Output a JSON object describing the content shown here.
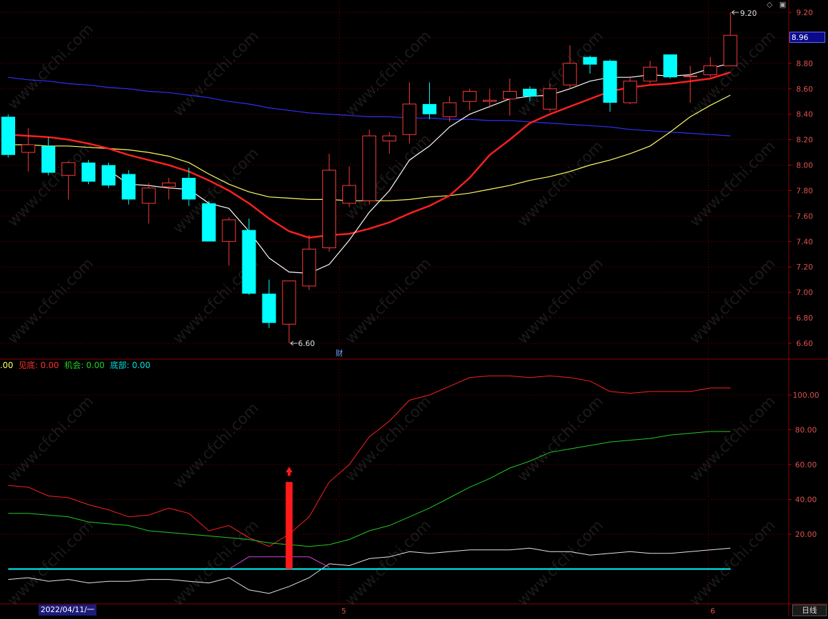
{
  "app": {
    "watermark": "www.cfchi.com",
    "period_label": "日线",
    "cursor_date": "2022/04/11/一",
    "last_price_tag": "8.96",
    "high_marker": "9.20",
    "low_marker": "6.60",
    "event_marker": "财",
    "icons": [
      "diamond-icon",
      "window-icon"
    ]
  },
  "colors": {
    "up": "#ff3b3b",
    "down": "#00ffff",
    "ma5": "#ffffff",
    "ma10": "#ff2020",
    "ma20": "#ffff66",
    "ma60": "#3030ff",
    "grid": "#7a0000",
    "ind_red": "#ff2020",
    "ind_green": "#20d020",
    "ind_white": "#e8e8e8",
    "ind_cyan": "#00ffff",
    "ind_magenta": "#e040e0"
  },
  "legend": [
    {
      "label": ".00",
      "color": "#ffff66"
    },
    {
      "label": "见底: 0.00",
      "color": "#ff3030"
    },
    {
      "label": "机会: 0.00",
      "color": "#20d020"
    },
    {
      "label": "底部: 0.00",
      "color": "#00e0e0"
    }
  ],
  "chart_data": [
    {
      "type": "candlestick",
      "ylim": [
        6.5,
        9.25
      ],
      "yticks": [
        "9.20",
        "9.00",
        "8.80",
        "8.60",
        "8.40",
        "8.20",
        "8.00",
        "7.80",
        "7.60",
        "7.40",
        "7.20",
        "7.00",
        "6.80",
        "6.60"
      ],
      "xticks": [
        {
          "label": "5",
          "index": 16.5
        },
        {
          "label": "6",
          "index": 34.9
        }
      ],
      "candles": [
        {
          "o": 8.38,
          "h": 8.4,
          "l": 8.06,
          "c": 8.08
        },
        {
          "o": 8.1,
          "h": 8.29,
          "l": 7.95,
          "c": 8.16
        },
        {
          "o": 8.15,
          "h": 8.22,
          "l": 7.92,
          "c": 7.94
        },
        {
          "o": 7.92,
          "h": 8.03,
          "l": 7.73,
          "c": 8.02
        },
        {
          "o": 8.02,
          "h": 8.04,
          "l": 7.85,
          "c": 7.87
        },
        {
          "o": 8.0,
          "h": 8.02,
          "l": 7.82,
          "c": 7.84
        },
        {
          "o": 7.93,
          "h": 7.96,
          "l": 7.69,
          "c": 7.73
        },
        {
          "o": 7.7,
          "h": 7.86,
          "l": 7.54,
          "c": 7.82
        },
        {
          "o": 7.83,
          "h": 7.9,
          "l": 7.73,
          "c": 7.86
        },
        {
          "o": 7.9,
          "h": 7.98,
          "l": 7.68,
          "c": 7.73
        },
        {
          "o": 7.7,
          "h": 7.72,
          "l": 7.4,
          "c": 7.4
        },
        {
          "o": 7.4,
          "h": 7.59,
          "l": 7.21,
          "c": 7.57
        },
        {
          "o": 7.49,
          "h": 7.58,
          "l": 6.98,
          "c": 6.99
        },
        {
          "o": 6.99,
          "h": 7.1,
          "l": 6.72,
          "c": 6.76
        },
        {
          "o": 6.75,
          "h": 7.09,
          "l": 6.6,
          "c": 7.09
        },
        {
          "o": 7.05,
          "h": 7.45,
          "l": 7.02,
          "c": 7.34
        },
        {
          "o": 7.35,
          "h": 8.09,
          "l": 7.32,
          "c": 7.96
        },
        {
          "o": 7.7,
          "h": 7.99,
          "l": 7.67,
          "c": 7.84
        },
        {
          "o": 7.72,
          "h": 8.28,
          "l": 7.69,
          "c": 8.23
        },
        {
          "o": 8.19,
          "h": 8.26,
          "l": 8.09,
          "c": 8.23
        },
        {
          "o": 8.24,
          "h": 8.65,
          "l": 8.17,
          "c": 8.48
        },
        {
          "o": 8.48,
          "h": 8.65,
          "l": 8.36,
          "c": 8.4
        },
        {
          "o": 8.38,
          "h": 8.54,
          "l": 8.34,
          "c": 8.49
        },
        {
          "o": 8.5,
          "h": 8.6,
          "l": 8.43,
          "c": 8.58
        },
        {
          "o": 8.5,
          "h": 8.6,
          "l": 8.45,
          "c": 8.51
        },
        {
          "o": 8.52,
          "h": 8.68,
          "l": 8.39,
          "c": 8.58
        },
        {
          "o": 8.6,
          "h": 8.62,
          "l": 8.5,
          "c": 8.54
        },
        {
          "o": 8.44,
          "h": 8.64,
          "l": 8.42,
          "c": 8.6
        },
        {
          "o": 8.63,
          "h": 8.94,
          "l": 8.6,
          "c": 8.8
        },
        {
          "o": 8.85,
          "h": 8.86,
          "l": 8.72,
          "c": 8.79
        },
        {
          "o": 8.82,
          "h": 8.83,
          "l": 8.42,
          "c": 8.49
        },
        {
          "o": 8.49,
          "h": 8.7,
          "l": 8.48,
          "c": 8.66
        },
        {
          "o": 8.66,
          "h": 8.82,
          "l": 8.64,
          "c": 8.77
        },
        {
          "o": 8.87,
          "h": 8.87,
          "l": 8.68,
          "c": 8.69
        },
        {
          "o": 8.7,
          "h": 8.78,
          "l": 8.49,
          "c": 8.7
        },
        {
          "o": 8.71,
          "h": 8.85,
          "l": 8.69,
          "c": 8.78
        },
        {
          "o": 8.78,
          "h": 9.2,
          "l": 8.78,
          "c": 9.02
        }
      ],
      "ma5": [
        null,
        null,
        null,
        null,
        null,
        7.96,
        7.85,
        7.84,
        7.82,
        7.81,
        7.7,
        7.66,
        7.48,
        7.27,
        7.16,
        7.15,
        7.22,
        7.41,
        7.63,
        7.8,
        8.04,
        8.15,
        8.3,
        8.4,
        8.46,
        8.52,
        8.54,
        8.55,
        8.6,
        8.66,
        8.69,
        8.69,
        8.71,
        8.7,
        8.71,
        8.76,
        8.8
      ],
      "ma10": [
        8.24,
        8.23,
        8.22,
        8.2,
        8.17,
        8.13,
        8.08,
        8.04,
        8.0,
        7.95,
        7.88,
        7.8,
        7.7,
        7.58,
        7.48,
        7.43,
        7.45,
        7.46,
        7.5,
        7.55,
        7.62,
        7.68,
        7.76,
        7.9,
        8.08,
        8.2,
        8.33,
        8.4,
        8.46,
        8.52,
        8.58,
        8.61,
        8.63,
        8.64,
        8.66,
        8.68,
        8.73
      ],
      "ma20": [
        8.16,
        8.16,
        8.15,
        8.15,
        8.14,
        8.13,
        8.12,
        8.1,
        8.07,
        8.02,
        7.93,
        7.85,
        7.79,
        7.75,
        7.74,
        7.73,
        7.73,
        7.72,
        7.72,
        7.72,
        7.73,
        7.75,
        7.76,
        7.78,
        7.81,
        7.84,
        7.88,
        7.91,
        7.95,
        8.0,
        8.04,
        8.09,
        8.15,
        8.26,
        8.38,
        8.47,
        8.55
      ],
      "ma60": [
        8.69,
        8.67,
        8.66,
        8.64,
        8.63,
        8.61,
        8.6,
        8.58,
        8.57,
        8.55,
        8.53,
        8.5,
        8.48,
        8.45,
        8.43,
        8.41,
        8.4,
        8.39,
        8.38,
        8.38,
        8.37,
        8.37,
        8.36,
        8.36,
        8.35,
        8.35,
        8.34,
        8.33,
        8.32,
        8.31,
        8.3,
        8.28,
        8.27,
        8.26,
        8.25,
        8.24,
        8.23
      ]
    },
    {
      "type": "line",
      "ylim": [
        -20,
        120
      ],
      "yticks": [
        "100.00",
        "80.00",
        "60.00",
        "40.00",
        "20.00"
      ],
      "series": [
        {
          "values": [
            48,
            47,
            42,
            41,
            37,
            34,
            30,
            31,
            35,
            32,
            22,
            25,
            18,
            13,
            20,
            30,
            50,
            60,
            76,
            85,
            97,
            100,
            105,
            110,
            111,
            111,
            110,
            111,
            110,
            108,
            102,
            101,
            102,
            102,
            102,
            104,
            104
          ]
        },
        {
          "values": [
            32,
            32,
            31,
            30,
            27,
            26,
            25,
            22,
            21,
            20,
            19,
            18,
            17,
            15,
            14,
            13,
            14,
            17,
            22,
            25,
            30,
            35,
            41,
            47,
            52,
            58,
            62,
            67,
            69,
            71,
            73,
            74,
            75,
            77,
            78,
            79,
            79
          ]
        },
        {
          "values": [
            -6,
            -5,
            -7,
            -6,
            -8,
            -7,
            -7,
            -6,
            -6,
            -7,
            -8,
            -5,
            -12,
            -14,
            -10,
            -5,
            3,
            2,
            6,
            7,
            10,
            9,
            10,
            11,
            11,
            11,
            12,
            10,
            10,
            8,
            9,
            10,
            9,
            9,
            10,
            11,
            12
          ]
        },
        {
          "values": [
            0,
            0,
            0,
            0,
            0,
            0,
            0,
            0,
            0,
            0,
            0,
            0,
            0,
            0,
            0,
            0,
            0,
            0,
            0,
            0,
            0,
            0,
            0,
            0,
            0,
            0,
            0,
            0,
            0,
            0,
            0,
            0,
            0,
            0,
            0,
            0,
            0
          ]
        },
        {
          "values": [
            null,
            null,
            null,
            null,
            null,
            null,
            null,
            null,
            null,
            null,
            null,
            0,
            7,
            7,
            7,
            7,
            1,
            null,
            null,
            null,
            null,
            null,
            null,
            null,
            null,
            null,
            null,
            null,
            null,
            null,
            null,
            null,
            null,
            null,
            null,
            null,
            null
          ]
        }
      ],
      "bars": [
        {
          "index": 14,
          "value": 50
        }
      ]
    }
  ]
}
